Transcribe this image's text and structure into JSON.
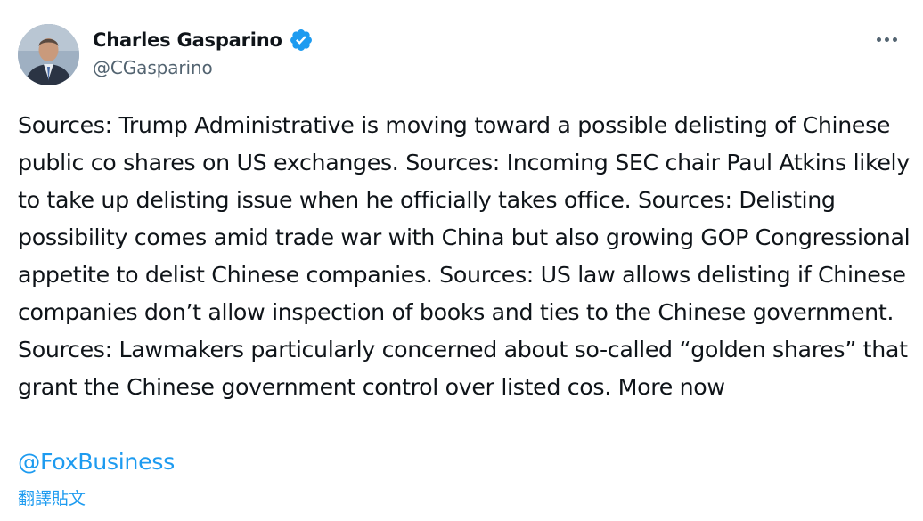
{
  "author": {
    "name": "Charles Gasparino",
    "handle": "@CGasparino",
    "verified": true
  },
  "tweet": {
    "text": "Sources: Trump Administrative is moving toward a possible delisting of Chinese public co shares on US exchanges. Sources: Incoming SEC chair Paul Atkins likely to take up delisting issue when he officially takes office. Sources: Delisting possibility comes amid trade war with China but also growing GOP Congressional appetite to delist Chinese companies. Sources: US law allows delisting if Chinese companies don’t allow inspection of books and ties to the Chinese government. Sources: Lawmakers particularly concerned about so-called “golden shares” that grant the Chinese government control over listed cos. More now",
    "mention": "@FoxBusiness",
    "translate_label": "翻譯貼文"
  },
  "icons": {
    "more": "more-options-icon",
    "verified": "verified-badge-icon"
  },
  "colors": {
    "link": "#1d9bf0",
    "text": "#0f1419",
    "secondary": "#536471"
  }
}
